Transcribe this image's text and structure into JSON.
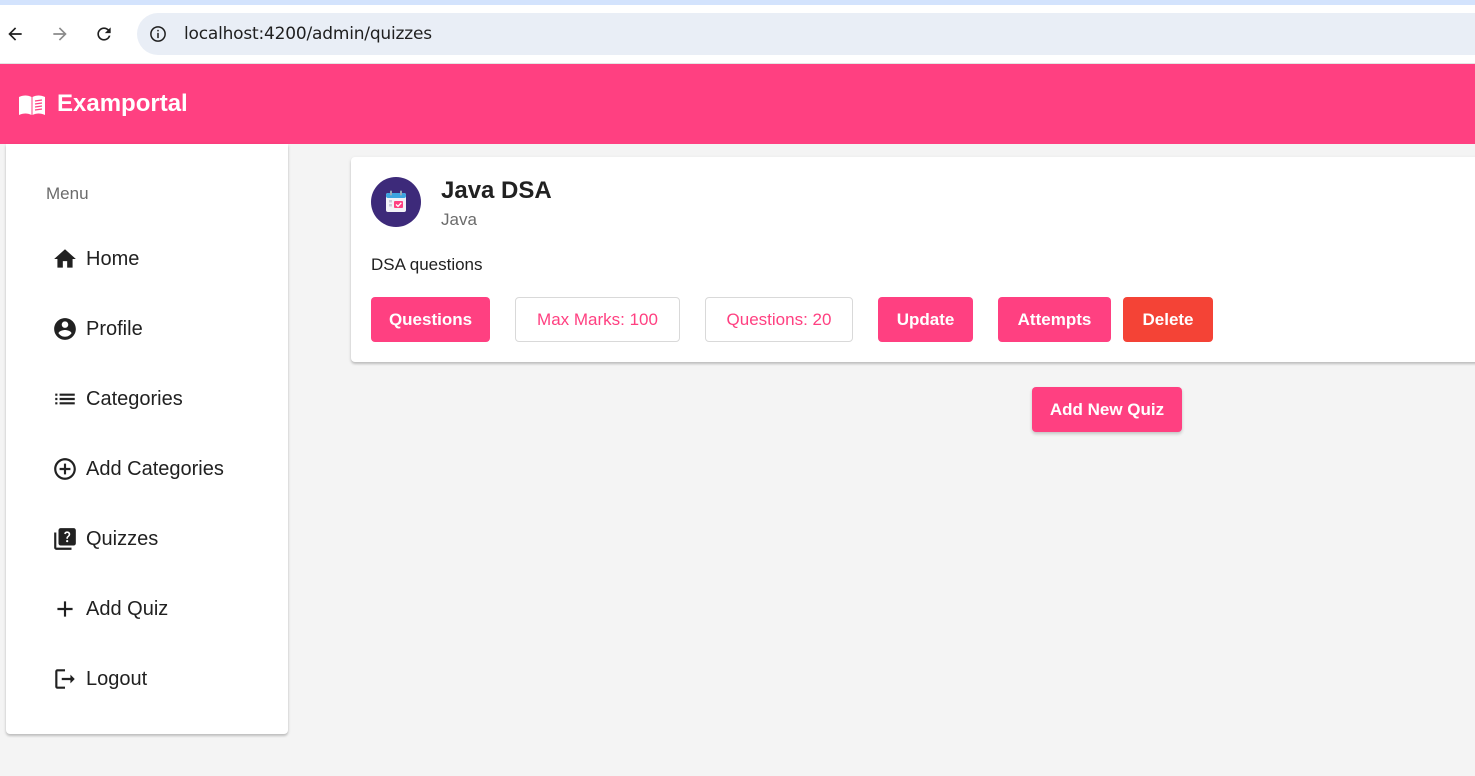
{
  "browser": {
    "url": "localhost:4200/admin/quizzes",
    "back_icon": "arrow-left-icon",
    "forward_icon": "arrow-right-icon",
    "reload_icon": "reload-icon",
    "info_icon": "info-icon"
  },
  "header": {
    "brand": "Examportal",
    "brand_icon": "book-open-icon",
    "color": "#ff4081"
  },
  "sidebar": {
    "title": "Menu",
    "items": [
      {
        "label": "Home",
        "icon": "home-icon"
      },
      {
        "label": "Profile",
        "icon": "account-circle-icon"
      },
      {
        "label": "Categories",
        "icon": "list-icon"
      },
      {
        "label": "Add Categories",
        "icon": "add-circle-icon"
      },
      {
        "label": "Quizzes",
        "icon": "quiz-icon"
      },
      {
        "label": "Add Quiz",
        "icon": "plus-icon"
      },
      {
        "label": "Logout",
        "icon": "logout-icon"
      }
    ]
  },
  "quiz": {
    "title": "Java DSA",
    "category": "Java",
    "description": "DSA questions",
    "avatar_icon": "calendar-icon",
    "buttons": {
      "questions": "Questions",
      "max_marks": "Max Marks: 100",
      "question_count": "Questions: 20",
      "update": "Update",
      "attempts": "Attempts",
      "delete": "Delete"
    }
  },
  "actions": {
    "add_new_quiz": "Add New Quiz"
  },
  "colors": {
    "accent": "#ff4081",
    "warn": "#f44336",
    "background": "#f4f4f4"
  }
}
